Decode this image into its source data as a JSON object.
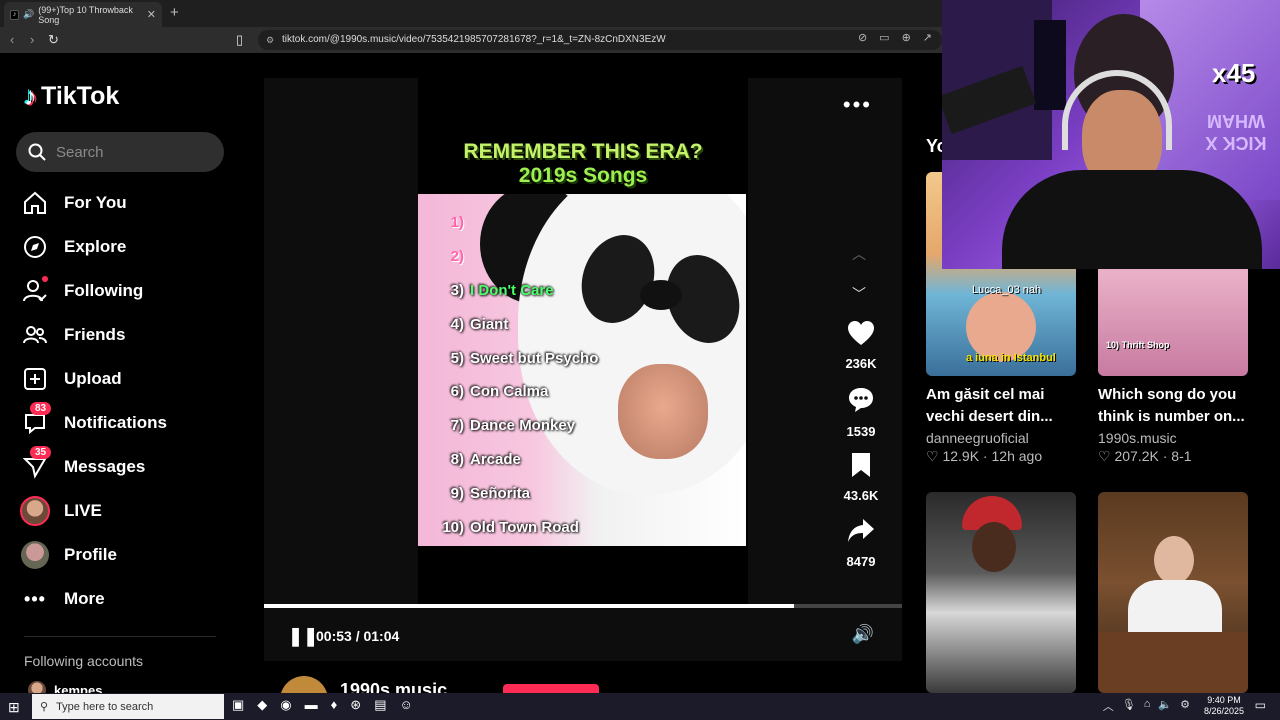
{
  "browser": {
    "tab_title": "(99+)Top 10 Throwback Song",
    "tab_favicon": "♪",
    "url": "tiktok.com/@1990s.music/video/7535421985707281678?_r=1&_t=ZN-8zCnDXN3EzW"
  },
  "app": {
    "name": "TikTok",
    "search_placeholder": "Search"
  },
  "nav": [
    {
      "label": "For You",
      "icon": "home-icon"
    },
    {
      "label": "Explore",
      "icon": "compass-icon"
    },
    {
      "label": "Following",
      "icon": "person-follow-icon"
    },
    {
      "label": "Friends",
      "icon": "friends-icon"
    },
    {
      "label": "Upload",
      "icon": "plus-square-icon"
    },
    {
      "label": "Notifications",
      "icon": "message-bubble-icon",
      "badge": "83"
    },
    {
      "label": "Messages",
      "icon": "send-icon",
      "badge": "35"
    },
    {
      "label": "LIVE",
      "icon": "live-avatar"
    },
    {
      "label": "Profile",
      "icon": "profile-avatar"
    },
    {
      "label": "More",
      "icon": "ellipsis-icon"
    }
  ],
  "following_accounts": {
    "heading": "Following accounts",
    "first": "kempes"
  },
  "video": {
    "title_line1": "REMEMBER THIS ERA?",
    "title_line2": "2019s Songs",
    "songs": [
      {
        "num": "1)",
        "title": ""
      },
      {
        "num": "2)",
        "title": ""
      },
      {
        "num": "3)",
        "title": "I Don't Care"
      },
      {
        "num": "4)",
        "title": "Giant"
      },
      {
        "num": "5)",
        "title": "Sweet but Psycho"
      },
      {
        "num": "6)",
        "title": "Con Calma"
      },
      {
        "num": "7)",
        "title": "Dance Monkey"
      },
      {
        "num": "8)",
        "title": "Arcade"
      },
      {
        "num": "9)",
        "title": "Señorita"
      },
      {
        "num": "10)",
        "title": "Old Town Road"
      }
    ],
    "likes": "236K",
    "comments": "1539",
    "saves": "43.6K",
    "shares": "8479",
    "current_time": "00:53",
    "duration": "01:04",
    "progress": 0.83,
    "author": "1990s music"
  },
  "recommendations": {
    "heading": "Yo",
    "cards": [
      {
        "title": "Am găsit cel mai vechi desert din...",
        "author": "danneegruoficial",
        "likes": "12.9K",
        "age": "12h ago",
        "overlay": "a iuna in Istanbul",
        "overlay2": "Lucca_03 nah"
      },
      {
        "title": "Which song do you think is number on...",
        "author": "1990s.music",
        "likes": "207.2K",
        "age": "8-1",
        "overlay": "10) Thrift Shop",
        "overlay2": ""
      },
      {
        "title": "",
        "author": "",
        "likes": "",
        "age": "",
        "overlay": "",
        "overlay2": ""
      },
      {
        "title": "",
        "author": "",
        "likes": "",
        "age": "",
        "overlay": "",
        "overlay2": ""
      }
    ]
  },
  "webcam": {
    "multiplier": "x45",
    "sign": "KICK X WHAM"
  },
  "taskbar": {
    "search_placeholder": "Type here to search",
    "time": "9:40 PM",
    "date": "8/26/2025"
  }
}
